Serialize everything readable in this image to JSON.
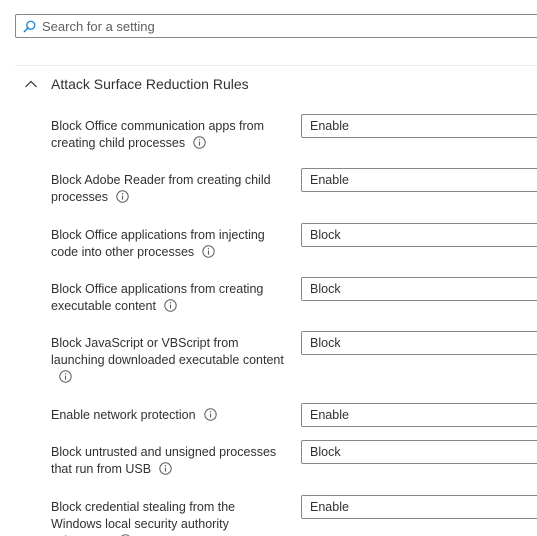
{
  "search": {
    "placeholder": "Search for a setting",
    "icon": "search-icon"
  },
  "section": {
    "title": "Attack Surface Reduction Rules",
    "expanded": true,
    "icon": "chevron-up-icon"
  },
  "settings": [
    {
      "label": "Block Office communication apps from creating child processes",
      "value": "Enable"
    },
    {
      "label": "Block Adobe Reader from creating child processes",
      "value": "Enable"
    },
    {
      "label": "Block Office applications from injecting code into other processes",
      "value": "Block"
    },
    {
      "label": "Block Office applications from creating executable content",
      "value": "Block"
    },
    {
      "label": "Block JavaScript or VBScript from launching downloaded executable content",
      "value": "Block"
    },
    {
      "label": "Enable network protection",
      "value": "Enable"
    },
    {
      "label": "Block untrusted and unsigned processes that run from USB",
      "value": "Block"
    },
    {
      "label": "Block credential stealing from the Windows local security authority subsystem",
      "value": "Enable"
    }
  ],
  "colors": {
    "border": "#8a8886",
    "text": "#323130",
    "divider": "#edebe9",
    "icon": "#605e5c"
  }
}
